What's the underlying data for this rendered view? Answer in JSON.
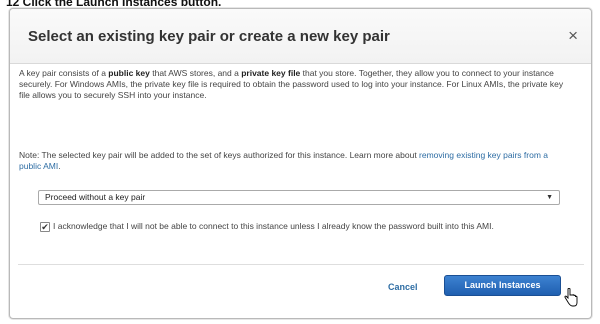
{
  "step_caption": "12 Click the Launch Instances button.",
  "dialog": {
    "title": "Select an existing key pair or create a new key pair",
    "close_label": "×",
    "intro": {
      "part1": "A key pair consists of a ",
      "public_key": "public key",
      "part2": " that AWS stores, and a ",
      "private_key_file": "private key file",
      "part3": " that you store. Together, they allow you to connect to your instance securely. For Windows AMIs, the private key file is required to obtain the password used to log into your instance. For Linux AMIs, the private key file allows you to securely SSH into your instance."
    },
    "note": {
      "text": "Note: The selected key pair will be added to the set of keys authorized for this instance. Learn more about ",
      "link": "removing existing key pairs from a public AMI",
      "end": "."
    },
    "select": {
      "value": "Proceed without a key pair"
    },
    "acknowledge": {
      "checked": true,
      "check_mark": "✔",
      "text": "I acknowledge that I will not be able to connect to this instance unless I already know the password built into this AMI."
    },
    "buttons": {
      "cancel": "Cancel",
      "launch": "Launch Instances"
    }
  }
}
